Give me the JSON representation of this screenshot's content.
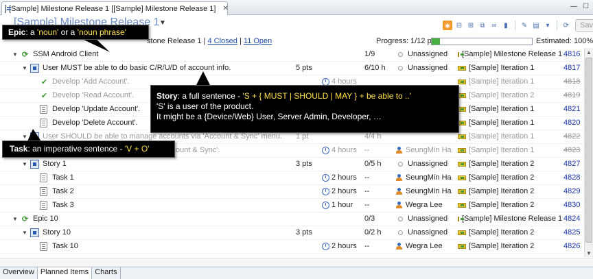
{
  "window": {
    "tab_title": "[Sample] Milestone Release 1 [[Sample] Milestone Release 1]",
    "tab_close": "✕",
    "minimize": "—",
    "maximize": "☐"
  },
  "header": {
    "page_title": "[Sample] Milestone Release 1",
    "save_label": "Save",
    "crumb_prefix": "stone Release 1 |",
    "closed_link": "4 Closed",
    "separator": "|",
    "open_link": "11 Open",
    "progress_label": "Progress: 1/12 pts",
    "progress_fraction": 0.0833,
    "estimated_label": "Estimated: 100%"
  },
  "rows": [
    {
      "label": "SSM Android Client",
      "points": "",
      "estimate": "",
      "progress": "1/9",
      "owner": "Unassigned",
      "iteration": "[Sample] Milestone Release 1",
      "id": "4816",
      "type": "epic",
      "done": false
    },
    {
      "label": "User MUST be able to do basic C/R/U/D of account info.",
      "points": "5 pts",
      "estimate": "",
      "progress": "6/10 h",
      "owner": "Unassigned",
      "iteration": "[Sample] Iteration 1",
      "id": "4817",
      "type": "story",
      "done": false
    },
    {
      "label": "Develop 'Add Account'.",
      "points": "",
      "estimate": "4 hours",
      "progress": "",
      "owner": "",
      "iteration": "[Sample] Iteration 1",
      "id": "4818",
      "type": "task",
      "done": true
    },
    {
      "label": "Develop 'Read Account'.",
      "points": "",
      "estimate": "",
      "progress": "",
      "owner": "",
      "iteration": "[Sample] Iteration 2",
      "id": "4819",
      "type": "task",
      "done": true
    },
    {
      "label": "Develop 'Update Account'.",
      "points": "",
      "estimate": "",
      "progress": "",
      "owner": "",
      "iteration": "[Sample] Iteration 1",
      "id": "4821",
      "type": "task",
      "done": false
    },
    {
      "label": "Develop 'Delete Account'.",
      "points": "",
      "estimate": "",
      "progress": "",
      "owner": "",
      "iteration": "[Sample] Iteration 1",
      "id": "4820",
      "type": "task",
      "done": false
    },
    {
      "label": "User SHOULD be able to manage accounts via 'Account & Sync' menu.",
      "points": "1 pt",
      "estimate": "",
      "progress": "4/4 h",
      "owner": "",
      "iteration": "[Sample] Iteration 1",
      "id": "4822",
      "type": "story",
      "done": true
    },
    {
      "label": "Make account info visible on the 'Account & Sync'.",
      "points": "",
      "estimate": "4 hours",
      "progress": "--",
      "owner": "SeungMin Ha",
      "iteration": "[Sample] Iteration 1",
      "id": "4823",
      "type": "task",
      "done": true
    },
    {
      "label": "Story 1",
      "points": "3 pts",
      "estimate": "",
      "progress": "0/5 h",
      "owner": "Unassigned",
      "iteration": "[Sample] Iteration 2",
      "id": "4827",
      "type": "story",
      "done": false
    },
    {
      "label": "Task 1",
      "points": "",
      "estimate": "2 hours",
      "progress": "--",
      "owner": "SeungMin Ha",
      "iteration": "[Sample] Iteration 2",
      "id": "4828",
      "type": "task",
      "done": false
    },
    {
      "label": "Task 2",
      "points": "",
      "estimate": "2 hours",
      "progress": "--",
      "owner": "SeungMin Ha",
      "iteration": "[Sample] Iteration 2",
      "id": "4829",
      "type": "task",
      "done": false
    },
    {
      "label": "Task 3",
      "points": "",
      "estimate": "1 hour",
      "progress": "--",
      "owner": "Wegra Lee",
      "iteration": "[Sample] Iteration 2",
      "id": "4830",
      "type": "task",
      "done": false
    },
    {
      "label": "Epic 10",
      "points": "",
      "estimate": "",
      "progress": "0/3",
      "owner": "Unassigned",
      "iteration": "[Sample] Milestone Release 1",
      "id": "4824",
      "type": "epic",
      "done": false
    },
    {
      "label": "Story 10",
      "points": "3 pts",
      "estimate": "",
      "progress": "0/2 h",
      "owner": "Unassigned",
      "iteration": "[Sample] Iteration 2",
      "id": "4825",
      "type": "story",
      "done": false
    },
    {
      "label": "Task 10",
      "points": "",
      "estimate": "2 hours",
      "progress": "--",
      "owner": "Wegra Lee",
      "iteration": "[Sample] Iteration 2",
      "id": "4826",
      "type": "task",
      "done": false
    }
  ],
  "bottom_tabs": [
    "Overview",
    "Planned Items",
    "Charts"
  ],
  "callouts": {
    "epic": {
      "term": "Epic",
      "pre": ": a ",
      "q1": "'noun'",
      "mid": " or a ",
      "q2": "'noun phrase'"
    },
    "story": {
      "term": "Story",
      "pre": ": a full sentence - ",
      "formula": "'S + { MUST | SHOULD | MAY } + be able to ..'",
      "line2": "'S' is a user of the product.",
      "line3": "It might be a {Device/Web} User, Server Admin, Developer, …"
    },
    "task": {
      "term": "Task",
      "pre": ": an imperative sentence - ",
      "formula": "'V + O'"
    }
  },
  "colors": {
    "accent": "#1a34a8",
    "callout_bg": "#000000",
    "callout_highlight": "#ffe14a",
    "progress": "#48b040"
  }
}
